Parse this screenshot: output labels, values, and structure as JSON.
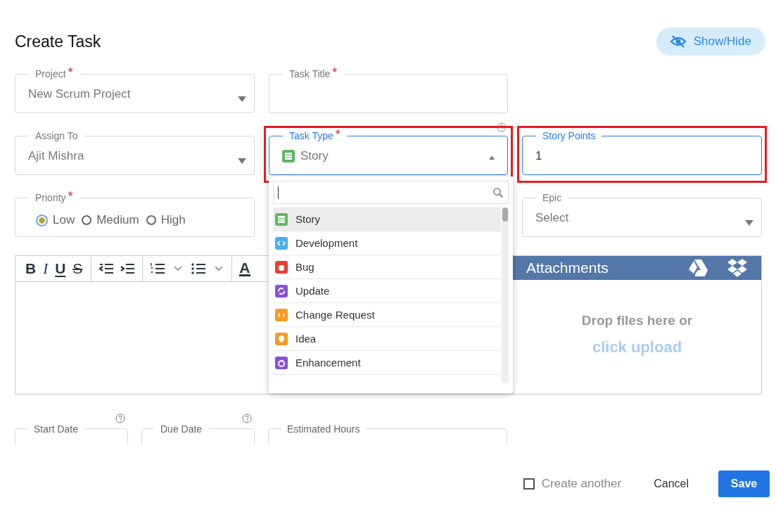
{
  "dialog": {
    "title": "Create Task",
    "show_hide_button": "Show/Hide"
  },
  "fields": [
    {
      "kind": "select",
      "label": "Project",
      "required_mark": "*",
      "value": "New Scrum Project",
      "focused": false,
      "highlighted": false
    },
    {
      "kind": "text",
      "label": "Task Title",
      "required_mark": "*",
      "focused": false,
      "highlighted": false
    },
    {
      "kind": "select",
      "label": "Assign To",
      "value": "Ajit Mishra",
      "focused": false,
      "highlighted": false
    },
    {
      "kind": "type_select",
      "label": "Task Type",
      "required_mark": "*",
      "value": "Story",
      "expanded": true,
      "focused": true,
      "highlighted": true
    },
    {
      "kind": "text",
      "label": "Story Points",
      "value": "1",
      "focused": true,
      "highlighted": true
    },
    {
      "kind": "radio",
      "label": "Priority",
      "required_mark": "*",
      "options": [
        {
          "label": "Low",
          "selected": true
        },
        {
          "label": "Medium",
          "selected": false
        },
        {
          "label": "High",
          "selected": false
        }
      ]
    },
    {
      "kind": "select",
      "label": "Epic",
      "value": "Select",
      "focused": false,
      "highlighted": false
    }
  ],
  "task_type_menu": {
    "items": [
      {
        "label": "Story",
        "kind": "story",
        "color": "#5cb85c",
        "selected": true
      },
      {
        "label": "Development",
        "kind": "development",
        "color": "#4aaee8",
        "selected": false
      },
      {
        "label": "Bug",
        "kind": "bug",
        "color": "#ee3b2f",
        "selected": false
      },
      {
        "label": "Update",
        "kind": "update",
        "color": "#8a4fd8",
        "selected": false
      },
      {
        "label": "Change Request",
        "kind": "change",
        "color": "#f79a1f",
        "selected": false
      },
      {
        "label": "Idea",
        "kind": "idea",
        "color": "#f79a1f",
        "selected": false
      },
      {
        "label": "Enhancement",
        "kind": "enhancement",
        "color": "#8a4fd8",
        "selected": false
      }
    ]
  },
  "editor_toolbar": {
    "format_buttons": [
      "B",
      "I",
      "U",
      "S"
    ],
    "font_color_button": "A"
  },
  "attachments": {
    "title": "Attachments",
    "drop_text": "Drop files here or",
    "upload_link": "click upload"
  },
  "date_fields": [
    {
      "label": "Start Date",
      "help": true
    },
    {
      "label": "Due Date",
      "help": true
    },
    {
      "label": "Estimated Hours",
      "help": false
    }
  ],
  "footer": {
    "create_another": {
      "label": "Create another",
      "checked": false
    },
    "cancel": "Cancel",
    "save": "Save"
  }
}
